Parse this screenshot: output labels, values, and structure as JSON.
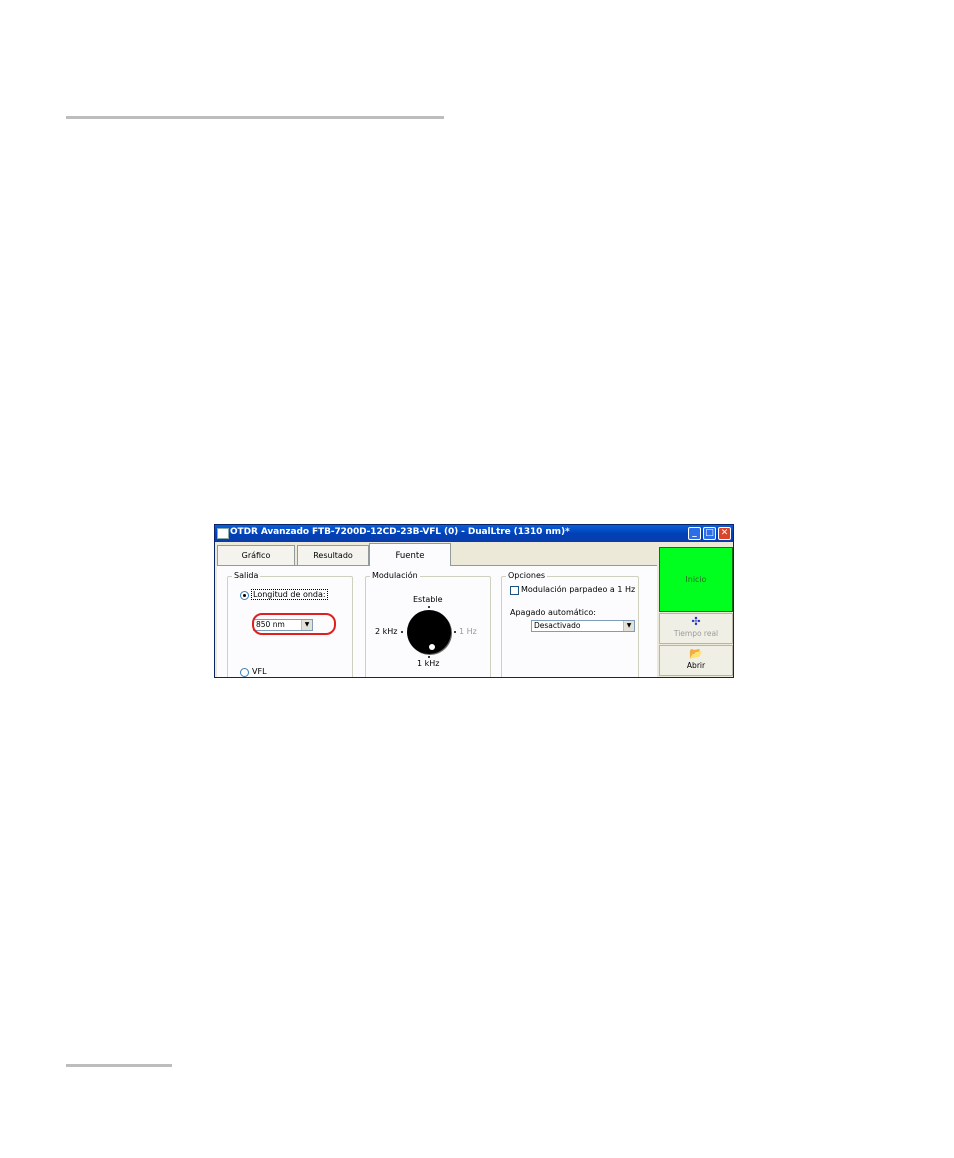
{
  "window": {
    "title": "OTDR Avanzado FTB-7200D-12CD-23B-VFL (0) - DualLtre (1310 nm)*",
    "buttons": {
      "minimize": "_",
      "maximize": "□",
      "close": "✕"
    }
  },
  "tabs": [
    {
      "label": "Gráfico"
    },
    {
      "label": "Resultado"
    },
    {
      "label": "Fuente",
      "active": true
    }
  ],
  "salida": {
    "group_label": "Salida",
    "wavelength_label": "Longitud de onda:",
    "wavelength_value": "850 nm",
    "vfl_label": "VFL"
  },
  "modulacion": {
    "group_label": "Modulación",
    "top": "Estable",
    "left": "2 kHz",
    "right": "1 Hz",
    "bottom": "1 kHz"
  },
  "opciones": {
    "group_label": "Opciones",
    "blink_label": "Modulación parpadeo a 1 Hz",
    "auto_off_label": "Apagado automático:",
    "auto_off_value": "Desactivado"
  },
  "right_panel": {
    "inicio": "Inicio",
    "tiempo_real": "Tiempo real",
    "abrir": "Abrir"
  },
  "colors": {
    "inicio_bg": "#00ff1e",
    "highlight_ring": "#e0201e",
    "titlebar": "#0a5fd8"
  }
}
